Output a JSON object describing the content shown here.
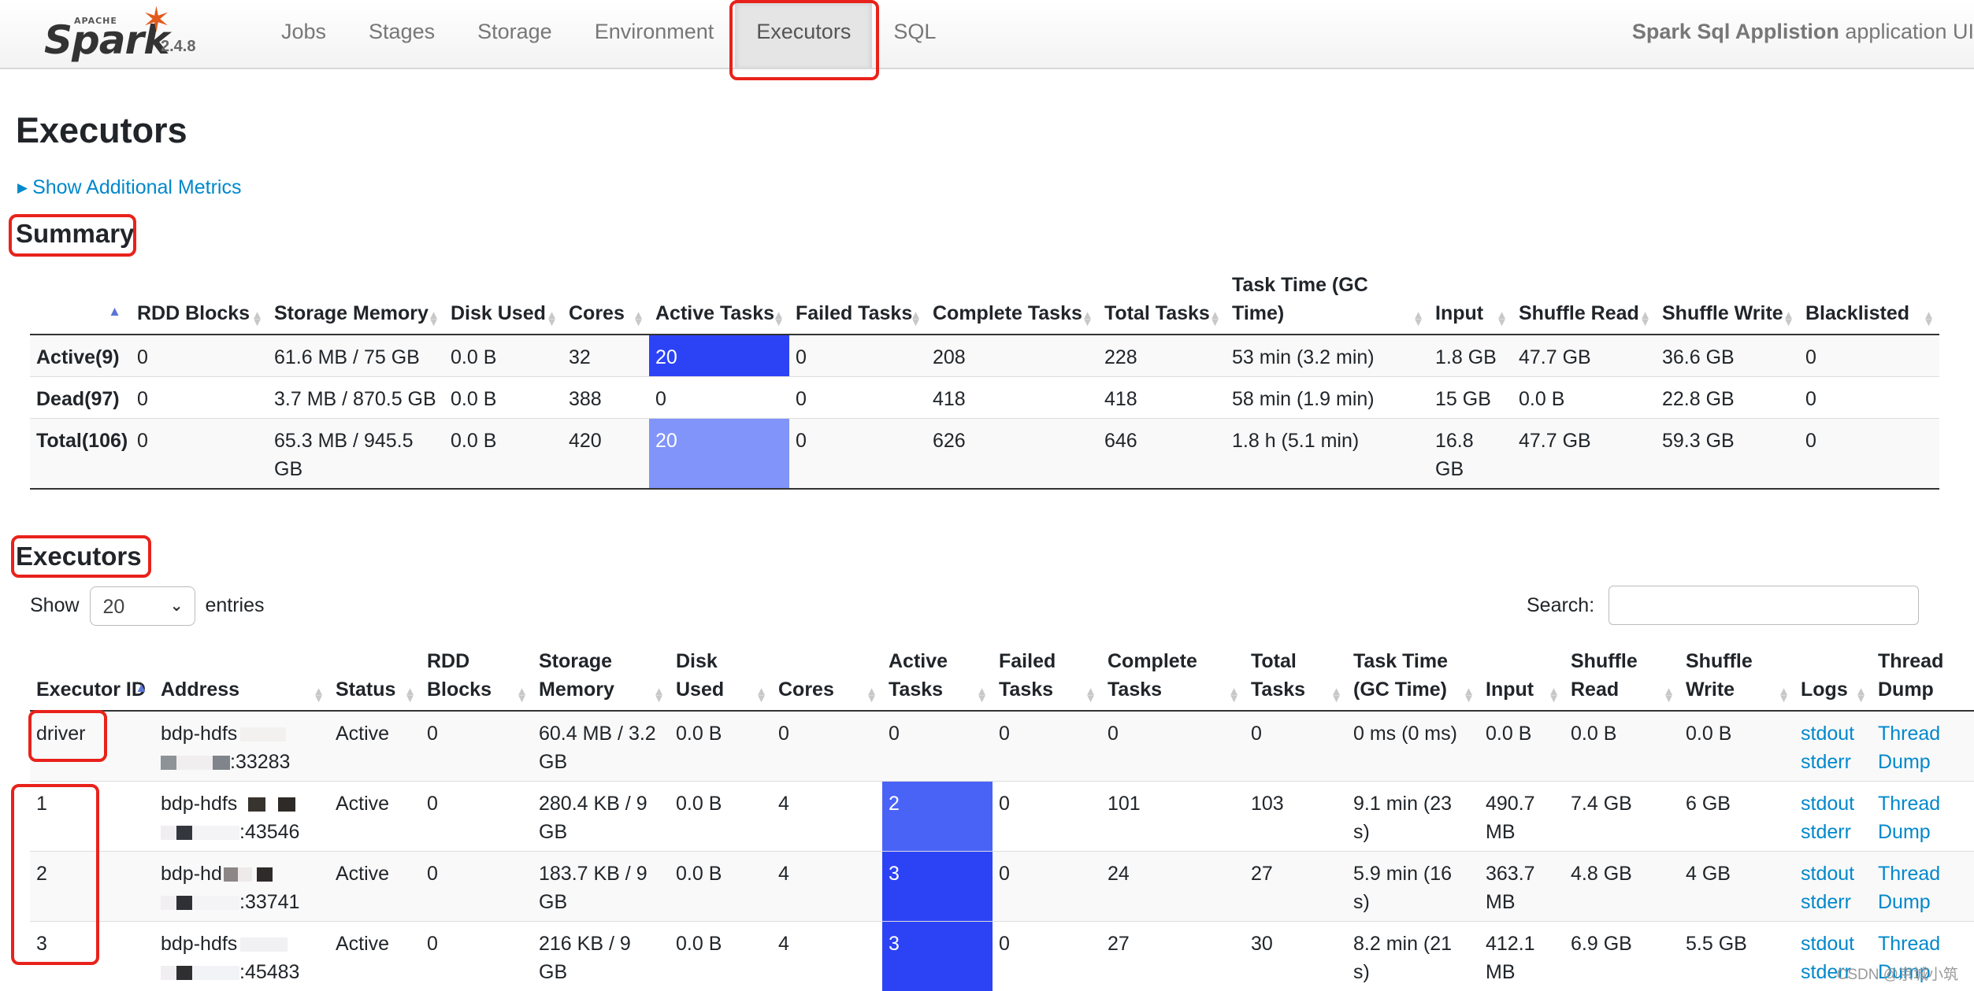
{
  "navbar": {
    "brand_apache": "APACHE",
    "brand_spark": "Spark",
    "version": "2.4.8",
    "tabs": [
      {
        "label": "Jobs"
      },
      {
        "label": "Stages"
      },
      {
        "label": "Storage"
      },
      {
        "label": "Environment"
      },
      {
        "label": "Executors"
      },
      {
        "label": "SQL"
      }
    ],
    "active_tab": "Executors",
    "app_name": "Spark Sql Applistion",
    "app_suffix": " application UI"
  },
  "page": {
    "title": "Executors",
    "show_metrics_link": "Show Additional Metrics"
  },
  "summary": {
    "heading": "Summary",
    "columns": [
      "",
      "RDD Blocks",
      "Storage Memory",
      "Disk Used",
      "Cores",
      "Active Tasks",
      "Failed Tasks",
      "Complete Tasks",
      "Total Tasks",
      "Task Time (GC Time)",
      "Input",
      "Shuffle Read",
      "Shuffle Write",
      "Blacklisted"
    ],
    "rows": [
      [
        "Active(9)",
        "0",
        "61.6 MB / 75 GB",
        "0.0 B",
        "32",
        "20",
        "0",
        "208",
        "228",
        "53 min (3.2 min)",
        "1.8 GB",
        "47.7 GB",
        "36.6 GB",
        "0"
      ],
      [
        "Dead(97)",
        "0",
        "3.7 MB / 870.5 GB",
        "0.0 B",
        "388",
        "0",
        "0",
        "418",
        "418",
        "58 min (1.9 min)",
        "15 GB",
        "0.0 B",
        "22.8 GB",
        "0"
      ],
      [
        "Total(106)",
        "0",
        "65.3 MB / 945.5 GB",
        "0.0 B",
        "420",
        "20",
        "0",
        "626",
        "646",
        "1.8 h (5.1 min)",
        "16.8 GB",
        "47.7 GB",
        "59.3 GB",
        "0"
      ]
    ]
  },
  "executors": {
    "heading": "Executors",
    "length_prefix": "Show",
    "length_value": "20",
    "length_suffix": "entries",
    "search_label": "Search:",
    "columns": [
      "Executor ID",
      "Address",
      "Status",
      "RDD Blocks",
      "Storage Memory",
      "Disk Used",
      "Cores",
      "Active Tasks",
      "Failed Tasks",
      "Complete Tasks",
      "Total Tasks",
      "Task Time (GC Time)",
      "Input",
      "Shuffle Read",
      "Shuffle Write",
      "Logs",
      "Thread Dump"
    ],
    "rows": [
      {
        "id": "driver",
        "address": "bdp-hdfs",
        "port": ":33283",
        "status": "Active",
        "rdd": "0",
        "storage": "60.4 MB / 3.2 GB",
        "disk": "0.0 B",
        "cores": "0",
        "active": "0",
        "failed": "0",
        "complete": "0",
        "total": "0",
        "time": "0 ms (0 ms)",
        "input": "0.0 B",
        "sread": "0.0 B",
        "swrite": "0.0 B",
        "log1": "stdout",
        "log2": "stderr",
        "dump": "Thread Dump"
      },
      {
        "id": "1",
        "address": "bdp-hdfs",
        "port": ":43546",
        "status": "Active",
        "rdd": "0",
        "storage": "280.4 KB / 9 GB",
        "disk": "0.0 B",
        "cores": "4",
        "active": "2",
        "failed": "0",
        "complete": "101",
        "total": "103",
        "time": "9.1 min (23 s)",
        "input": "490.7 MB",
        "sread": "7.4 GB",
        "swrite": "6 GB",
        "log1": "stdout",
        "log2": "stderr",
        "dump": "Thread Dump"
      },
      {
        "id": "2",
        "address": "bdp-hd",
        "port": ":33741",
        "status": "Active",
        "rdd": "0",
        "storage": "183.7 KB / 9 GB",
        "disk": "0.0 B",
        "cores": "4",
        "active": "3",
        "failed": "0",
        "complete": "24",
        "total": "27",
        "time": "5.9 min (16 s)",
        "input": "363.7 MB",
        "sread": "4.8 GB",
        "swrite": "4 GB",
        "log1": "stdout",
        "log2": "stderr",
        "dump": "Thread Dump"
      },
      {
        "id": "3",
        "address": "bdp-hdfs",
        "port": ":45483",
        "status": "Active",
        "rdd": "0",
        "storage": "216 KB / 9 GB",
        "disk": "0.0 B",
        "cores": "4",
        "active": "3",
        "failed": "0",
        "complete": "27",
        "total": "30",
        "time": "8.2 min (21 s)",
        "input": "412.1 MB",
        "sread": "6.9 GB",
        "swrite": "5.5 GB",
        "log1": "stdout",
        "log2": "stderr",
        "dump": "Thread Dump"
      }
    ]
  },
  "watermark": "CSDN @京城小筑",
  "colors": {
    "link": "#0088cc",
    "active_task_dark": "#2c43f5",
    "active_task_mid": "#4a63f7",
    "active_task_light": "#8094fa",
    "annotation_red": "#e8221b"
  }
}
